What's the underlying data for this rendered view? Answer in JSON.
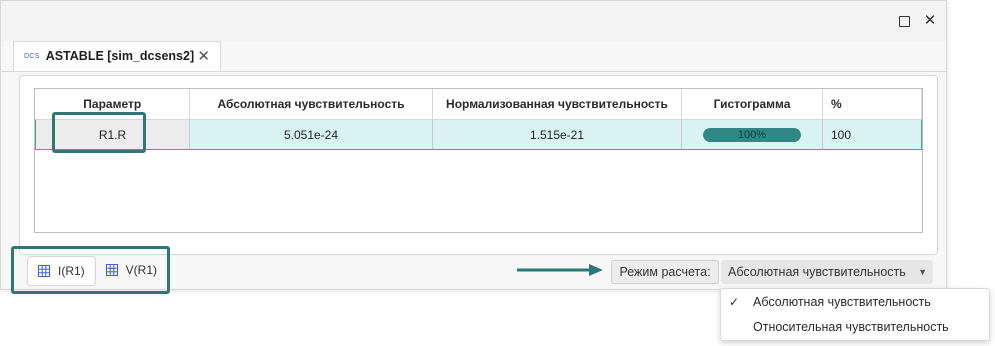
{
  "document_tab": {
    "icon_text": "DCS",
    "title": "ASTABLE [sim_dcsens2]"
  },
  "table": {
    "headers": [
      "Параметр",
      "Абсолютная чувствительность",
      "Нормализованная чувствительность",
      "Гистограмма",
      "%"
    ],
    "row": {
      "parameter": "R1.R",
      "absolute": "5.051e-24",
      "normalized": "1.515e-21",
      "histogram_label": "100%",
      "histogram_fraction": 1.0,
      "percent": "100"
    }
  },
  "bottom_tabs": [
    {
      "label": "I(R1)",
      "icon": "table-icon"
    },
    {
      "label": "V(R1)",
      "icon": "table-icon"
    }
  ],
  "mode": {
    "label": "Режим расчета:",
    "selected": "Абсолютная чувствительность",
    "options": [
      "Абсолютная чувствительность",
      "Относительная чувствительность"
    ]
  },
  "colors": {
    "accent": "#2f8886",
    "highlight": "#2f7775",
    "row_bg": "#d8f3f2"
  }
}
